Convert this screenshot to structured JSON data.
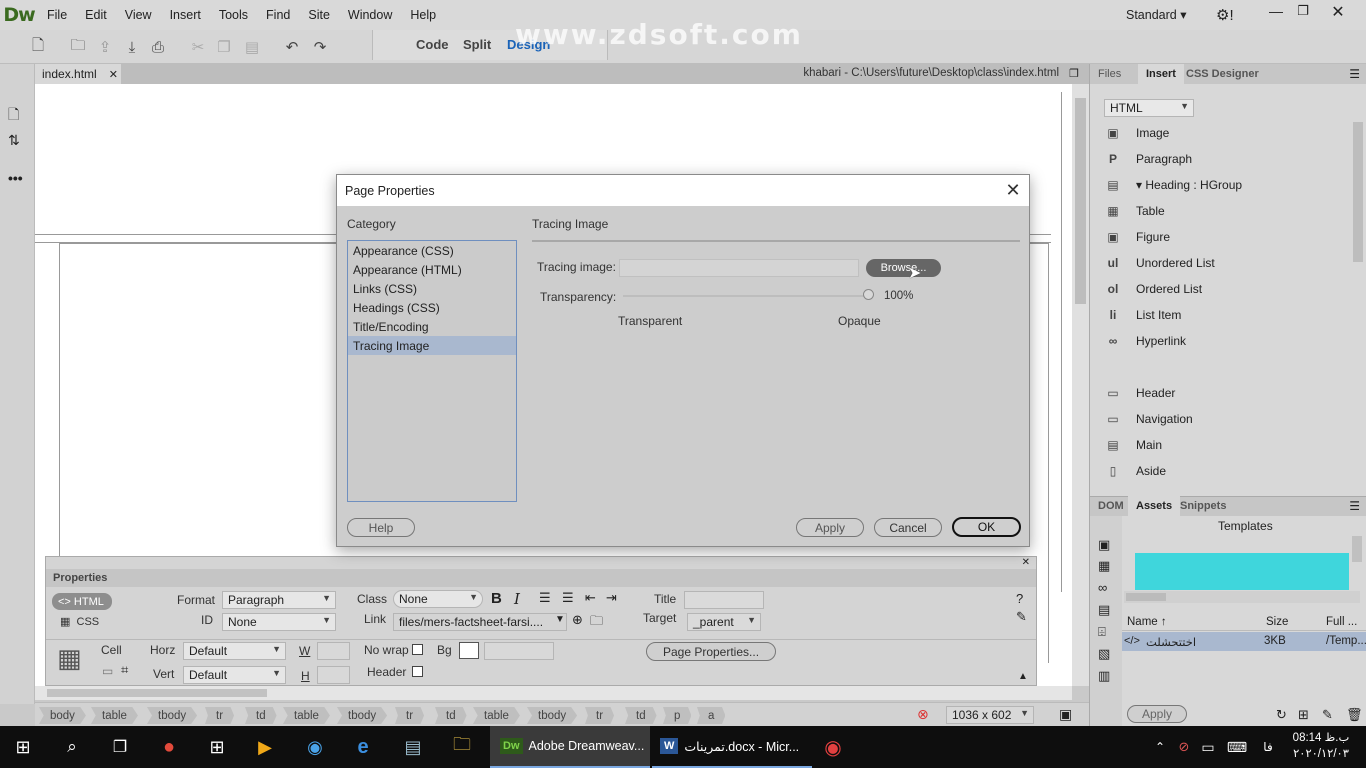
{
  "app": {
    "logo": "Dw",
    "workspace": "Standard"
  },
  "menu": [
    "File",
    "Edit",
    "View",
    "Insert",
    "Tools",
    "Find",
    "Site",
    "Window",
    "Help"
  ],
  "views": {
    "code": "Code",
    "split": "Split",
    "design": "Design"
  },
  "watermark": "www.zdsoft.com",
  "document": {
    "tab": "index.html",
    "path": "khabari - C:\\Users\\future\\Desktop\\class\\index.html"
  },
  "dialog": {
    "title": "Page Properties",
    "category_label": "Category",
    "categories": [
      "Appearance (CSS)",
      "Appearance (HTML)",
      "Links (CSS)",
      "Headings (CSS)",
      "Title/Encoding",
      "Tracing Image"
    ],
    "selected_category": "Tracing Image",
    "section_title": "Tracing Image",
    "tracing_image_label": "Tracing image:",
    "tracing_image_value": "",
    "browse_label": "Browse...",
    "transparency_label": "Transparency:",
    "transparency_value": "100%",
    "transparent_label": "Transparent",
    "opaque_label": "Opaque",
    "help": "Help",
    "apply": "Apply",
    "cancel": "Cancel",
    "ok": "OK"
  },
  "properties": {
    "title": "Properties",
    "html_btn": "HTML",
    "css_btn": "CSS",
    "format_label": "Format",
    "format_value": "Paragraph",
    "id_label": "ID",
    "id_value": "None",
    "class_label": "Class",
    "class_value": "None",
    "link_label": "Link",
    "link_value": "files/mers-factsheet-farsi....",
    "title_label": "Title",
    "target_label": "Target",
    "target_value": "_parent",
    "cell_label": "Cell",
    "horz_label": "Horz",
    "horz_value": "Default",
    "vert_label": "Vert",
    "vert_value": "Default",
    "w_label": "W",
    "h_label": "H",
    "nowrap_label": "No wrap",
    "header_label": "Header",
    "bg_label": "Bg",
    "page_props_btn": "Page Properties..."
  },
  "tagbar": {
    "tags": [
      "body",
      "table",
      "tbody",
      "tr",
      "td",
      "table",
      "tbody",
      "tr",
      "td",
      "table",
      "tbody",
      "tr",
      "td",
      "p",
      "a"
    ],
    "size": "1036 x 602"
  },
  "right_panel": {
    "tabs": [
      "Files",
      "Insert",
      "CSS Designer"
    ],
    "active_tab": "Insert",
    "dropdown": "HTML",
    "items": [
      {
        "glyph": "▣",
        "label": "Image"
      },
      {
        "glyph": "P",
        "label": "Paragraph"
      },
      {
        "glyph": "▤",
        "label": "▾ Heading : HGroup"
      },
      {
        "glyph": "▦",
        "label": "Table"
      },
      {
        "glyph": "▣",
        "label": "Figure"
      },
      {
        "glyph": "ul",
        "label": "Unordered List"
      },
      {
        "glyph": "ol",
        "label": "Ordered List"
      },
      {
        "glyph": "li",
        "label": "List Item"
      },
      {
        "glyph": "∞",
        "label": "Hyperlink"
      },
      {
        "glyph": "▭",
        "label": "Header"
      },
      {
        "glyph": "▭",
        "label": "Navigation"
      },
      {
        "glyph": "▤",
        "label": "Main"
      },
      {
        "glyph": "▯",
        "label": "Aside"
      }
    ],
    "lower_tabs": [
      "DOM",
      "Assets",
      "Snippets"
    ],
    "lower_active": "Assets",
    "templates_label": "Templates",
    "col_name": "Name ↑",
    "col_size": "Size",
    "col_full": "Full ...",
    "row_name": "اختتحشلت",
    "row_size": "3KB",
    "row_full": "/Temp...",
    "apply_btn": "Apply"
  },
  "taskbar": {
    "dw_task": "Adobe Dreamweav...",
    "word_task": "تمرینات.docx - Micr...",
    "lang": "فا",
    "time": "08:14 ب.ظ",
    "date": "۲۰۲۰/۱۲/۰۳"
  },
  "colors": {
    "accent": "#1a63b8",
    "template_preview": "#3fd6dc",
    "selected_row": "#a9b8cf"
  }
}
